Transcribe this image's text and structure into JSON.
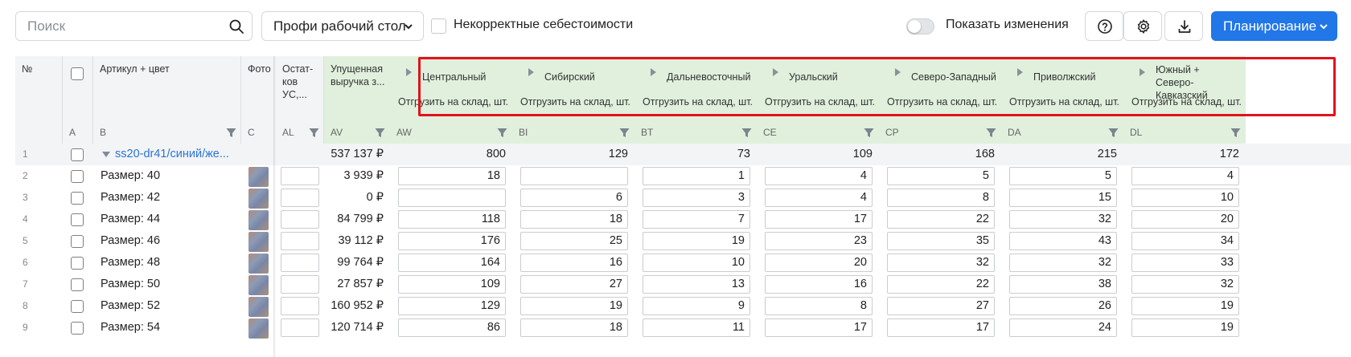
{
  "toolbar": {
    "search_placeholder": "Поиск",
    "workspace": "Профи рабочий стол",
    "incorrect_costs": "Некорректные себестоимости",
    "show_changes": "Показать изменения",
    "planning": "Планирование",
    "accent": "#2176e8"
  },
  "columns": {
    "num": {
      "title": "№",
      "letter": ""
    },
    "check": {
      "title": "",
      "letter": "A"
    },
    "article": {
      "title": "Артикул + цвет",
      "letter": "B"
    },
    "photo": {
      "title": "Фото",
      "letter": "C"
    },
    "stock": {
      "title": "Остат-ков УС,...",
      "letter": "AL"
    },
    "revenue": {
      "title": "Упущенная выручка з...",
      "letter": "AV"
    }
  },
  "regions_sub": "Отгрузить на склад, шт.",
  "regions": [
    {
      "name": "Центральный",
      "letter": "AW"
    },
    {
      "name": "Сибирский",
      "letter": "BI"
    },
    {
      "name": "Дальневосточный",
      "letter": "BT"
    },
    {
      "name": "Уральский",
      "letter": "CE"
    },
    {
      "name": "Северо-Западный",
      "letter": "CP"
    },
    {
      "name": "Приволжский",
      "letter": "DA"
    },
    {
      "name": "Южный + Северо-Кавказский",
      "letter": "DL"
    }
  ],
  "rows": [
    {
      "n": "1",
      "label": "ss20-dr41/синий/же...",
      "group": true,
      "revenue": "537 137 ₽",
      "vals": [
        "800",
        "129",
        "73",
        "109",
        "168",
        "215",
        "172"
      ]
    },
    {
      "n": "2",
      "label": "Размер: 40",
      "revenue": "3 939 ₽",
      "vals": [
        "18",
        "",
        "1",
        "4",
        "5",
        "5",
        "4"
      ]
    },
    {
      "n": "3",
      "label": "Размер: 42",
      "revenue": "0 ₽",
      "vals": [
        "",
        "6",
        "3",
        "4",
        "8",
        "15",
        "10"
      ]
    },
    {
      "n": "4",
      "label": "Размер: 44",
      "revenue": "84 799 ₽",
      "vals": [
        "118",
        "18",
        "7",
        "17",
        "22",
        "32",
        "20"
      ]
    },
    {
      "n": "5",
      "label": "Размер: 46",
      "revenue": "39 112 ₽",
      "vals": [
        "176",
        "25",
        "19",
        "23",
        "35",
        "43",
        "34"
      ]
    },
    {
      "n": "6",
      "label": "Размер: 48",
      "revenue": "99 764 ₽",
      "vals": [
        "164",
        "16",
        "10",
        "20",
        "32",
        "32",
        "33"
      ]
    },
    {
      "n": "7",
      "label": "Размер: 50",
      "revenue": "27 857 ₽",
      "vals": [
        "109",
        "27",
        "13",
        "16",
        "22",
        "38",
        "32"
      ]
    },
    {
      "n": "8",
      "label": "Размер: 52",
      "revenue": "160 952 ₽",
      "vals": [
        "129",
        "19",
        "9",
        "8",
        "27",
        "26",
        "19"
      ]
    },
    {
      "n": "9",
      "label": "Размер: 54",
      "revenue": "120 714 ₽",
      "vals": [
        "86",
        "18",
        "11",
        "17",
        "17",
        "24",
        "19"
      ]
    }
  ]
}
